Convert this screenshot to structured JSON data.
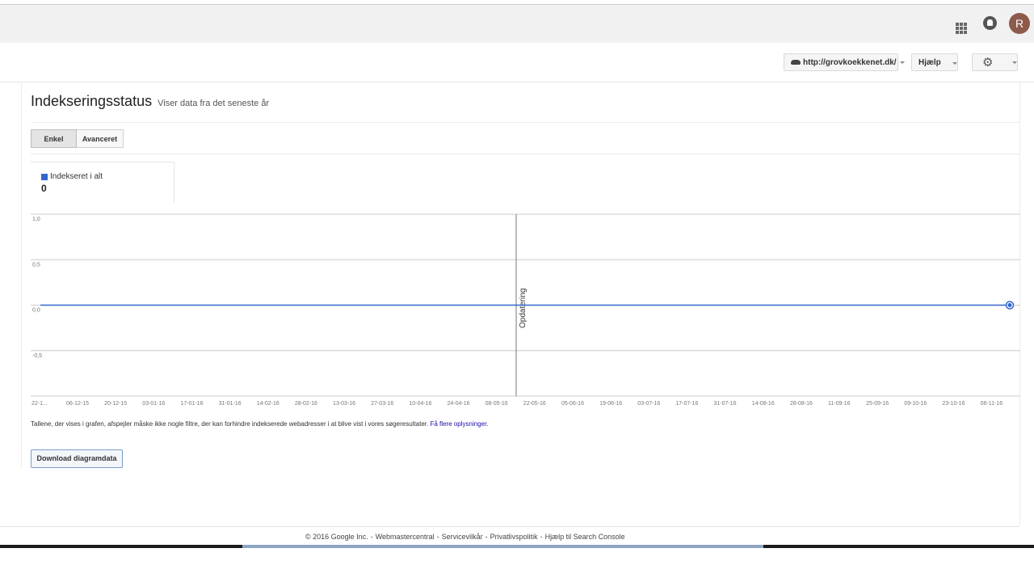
{
  "header": {
    "avatar_letter": "R",
    "icons": [
      "apps-icon",
      "bell-icon"
    ]
  },
  "toolbar": {
    "site": "http://grovkoekkenet.dk/",
    "help_label": "Hjælp",
    "settings_icon": "gear-icon"
  },
  "page": {
    "title": "Indekseringsstatus",
    "subtitle": "Viser data fra det seneste år"
  },
  "tabs": [
    {
      "label": "Enkel",
      "active": true
    },
    {
      "label": "Avanceret",
      "active": false
    }
  ],
  "metric": {
    "label": "Indekseret i alt",
    "value": "0",
    "color": "#3366cc"
  },
  "chart_data": {
    "type": "line",
    "title": "",
    "xlabel": "",
    "ylabel": "",
    "ylim": [
      -1.0,
      1.0
    ],
    "y_ticks": [
      "1,0",
      "0,5",
      "0,0",
      "-0,5"
    ],
    "y_tick_values": [
      1.0,
      0.5,
      0.0,
      -0.5
    ],
    "x_tick_labels": [
      "22-1...",
      "06-12-15",
      "20-12-15",
      "03-01-16",
      "17-01-16",
      "31-01-16",
      "14-02-16",
      "28-02-16",
      "13-03-16",
      "27-03-16",
      "10-04-16",
      "24-04-16",
      "08-05-16",
      "22-05-16",
      "05-06-16",
      "19-06-16",
      "03-07-16",
      "17-07-16",
      "31-07-16",
      "14-08-16",
      "28-08-16",
      "11-09-16",
      "25-09-16",
      "09-10-16",
      "23-10-16",
      "06-11-16"
    ],
    "grid": true,
    "series": [
      {
        "name": "Indekseret i alt",
        "color": "#3366cc",
        "values": [
          0,
          0,
          0,
          0,
          0,
          0,
          0,
          0,
          0,
          0,
          0,
          0,
          0,
          0,
          0,
          0,
          0,
          0,
          0,
          0,
          0,
          0,
          0,
          0,
          0,
          0,
          0
        ]
      }
    ],
    "annotations": [
      {
        "label": "Opdatering",
        "x_index": 12.85
      }
    ]
  },
  "footnote": {
    "text": "Tallene, der vises i grafen, afspejler måske ikke nogle filtre, der kan forhindre indekserede webadresser i at blive vist i vores søgeresultater. ",
    "link": "Få flere oplysninger",
    "end": "."
  },
  "download_label": "Download diagramdata",
  "footer": {
    "copyright": "© 2016 Google Inc.",
    "links": [
      "Webmastercentral",
      "Servicevilkår",
      "Privatlivspolitik",
      "Hjælp til Search Console"
    ]
  }
}
